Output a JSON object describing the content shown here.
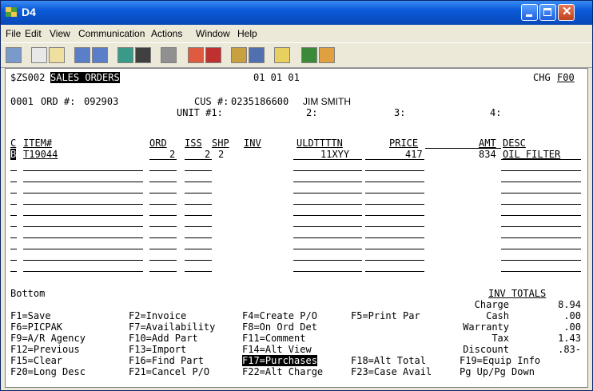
{
  "window": {
    "title": "D4"
  },
  "menu": [
    "File",
    "Edit",
    "View",
    "Communication",
    "Actions",
    "Window",
    "Help"
  ],
  "screen": {
    "program": "$ZS002",
    "screen_title": "SALES ORDERS",
    "date": "01 01 01",
    "chg": "CHG",
    "chg_code": "F00",
    "line_no": "0001",
    "order_label": "ORD #:",
    "order_no": "092903",
    "cus_label": "CUS #:",
    "cus_no": "0235186600",
    "cus_name": "JIM SMITH",
    "unit1": "UNIT #1:",
    "unit2": "2:",
    "unit3": "3:",
    "unit4": "4:",
    "headers": {
      "c": "C",
      "item": "ITEM#",
      "ord": "ORD",
      "iss": "ISS",
      "shp": "SHP",
      "inv": "INV",
      "uld": "ULDTTTTN",
      "price": "PRICE",
      "amt": "AMT",
      "desc": "DESC"
    },
    "row1": {
      "c": "B",
      "item": "T19044",
      "ord": "2",
      "iss": "2",
      "shp": "2",
      "uld": "11XYY",
      "price": "417",
      "amt": "834",
      "desc": "OIL FILTER"
    },
    "bottom": "Bottom",
    "totals_title": "INV TOTALS",
    "totals": [
      {
        "label": "Charge",
        "value": "8.94"
      },
      {
        "label": "Cash",
        "value": ".00"
      },
      {
        "label": "Warranty",
        "value": ".00"
      },
      {
        "label": "Tax",
        "value": "1.43"
      },
      {
        "label": "Discount",
        "value": ".83-"
      }
    ],
    "fkeys": [
      [
        "F1=Save",
        "F2=Invoice",
        "F4=Create P/O",
        "F5=Print Par"
      ],
      [
        "F6=PICPAK",
        "F7=Availability",
        "F8=On Ord Det",
        ""
      ],
      [
        "F9=A/R Agency",
        "F10=Add Part",
        "F11=Comment",
        ""
      ],
      [
        "F12=Previous",
        "F13=Import",
        "F14=Alt View",
        ""
      ],
      [
        "F15=Clear",
        "F16=Find Part",
        "F17=Purchases",
        "F18=Alt Total",
        "F19=Equip Info"
      ],
      [
        "F20=Long Desc",
        "F21=Cancel P/O",
        "F22=Alt Charge",
        "F23=Case Avail",
        "Pg Up/Pg Down"
      ]
    ]
  }
}
